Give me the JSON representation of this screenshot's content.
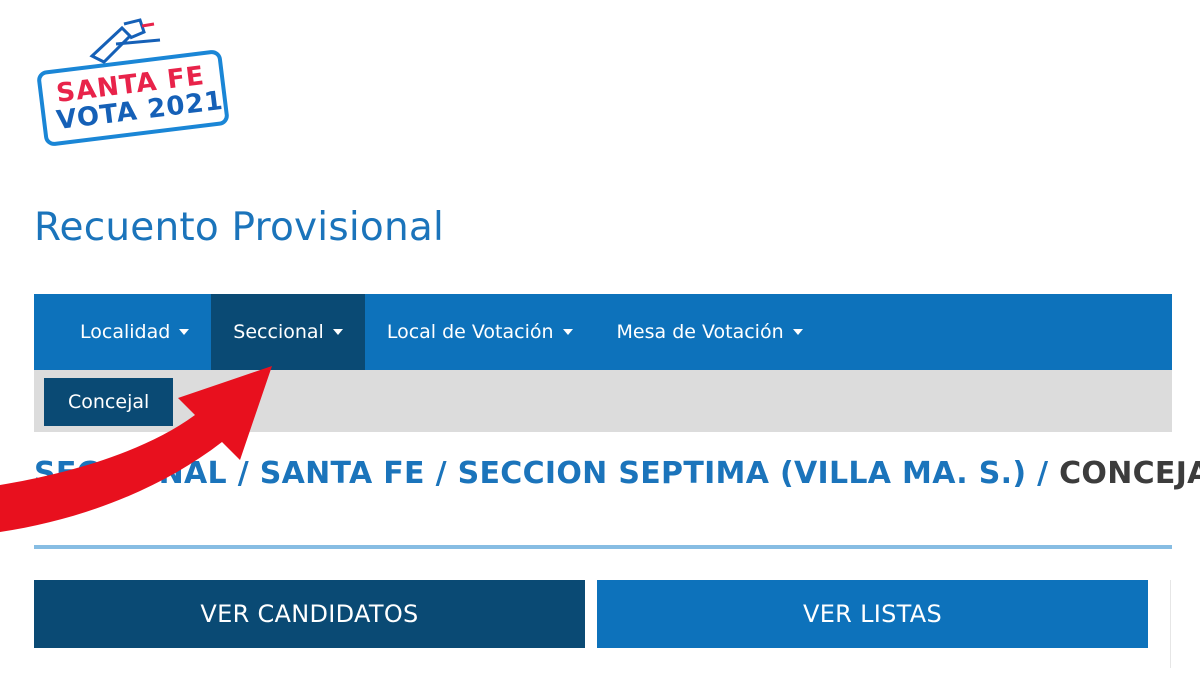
{
  "logo": {
    "line1": "SANTA FE",
    "line2": "VOTA 2021",
    "colors": {
      "red": "#e8234a",
      "blue": "#1560b7",
      "frame": "#1a86d6"
    }
  },
  "page_title": "Recuento Provisional",
  "nav": {
    "items": [
      {
        "label": "Localidad",
        "active": false
      },
      {
        "label": "Seccional",
        "active": true
      },
      {
        "label": "Local de Votación",
        "active": false
      },
      {
        "label": "Mesa de Votación",
        "active": false
      }
    ]
  },
  "subnav": {
    "item": "Concejal"
  },
  "breadcrumb": {
    "part1": "SECCIONAL",
    "part2": "SANTA FE",
    "part3": "SECCION SEPTIMA (VILLA MA. S.)",
    "current": "CONCEJAL",
    "separator": " / "
  },
  "buttons": {
    "candidatos": "VER CANDIDATOS",
    "listas": "VER LISTAS"
  },
  "colors": {
    "nav_bg": "#0d72bb",
    "nav_active": "#0a4a74",
    "title": "#1b74bb",
    "arrow": "#e8101e"
  }
}
